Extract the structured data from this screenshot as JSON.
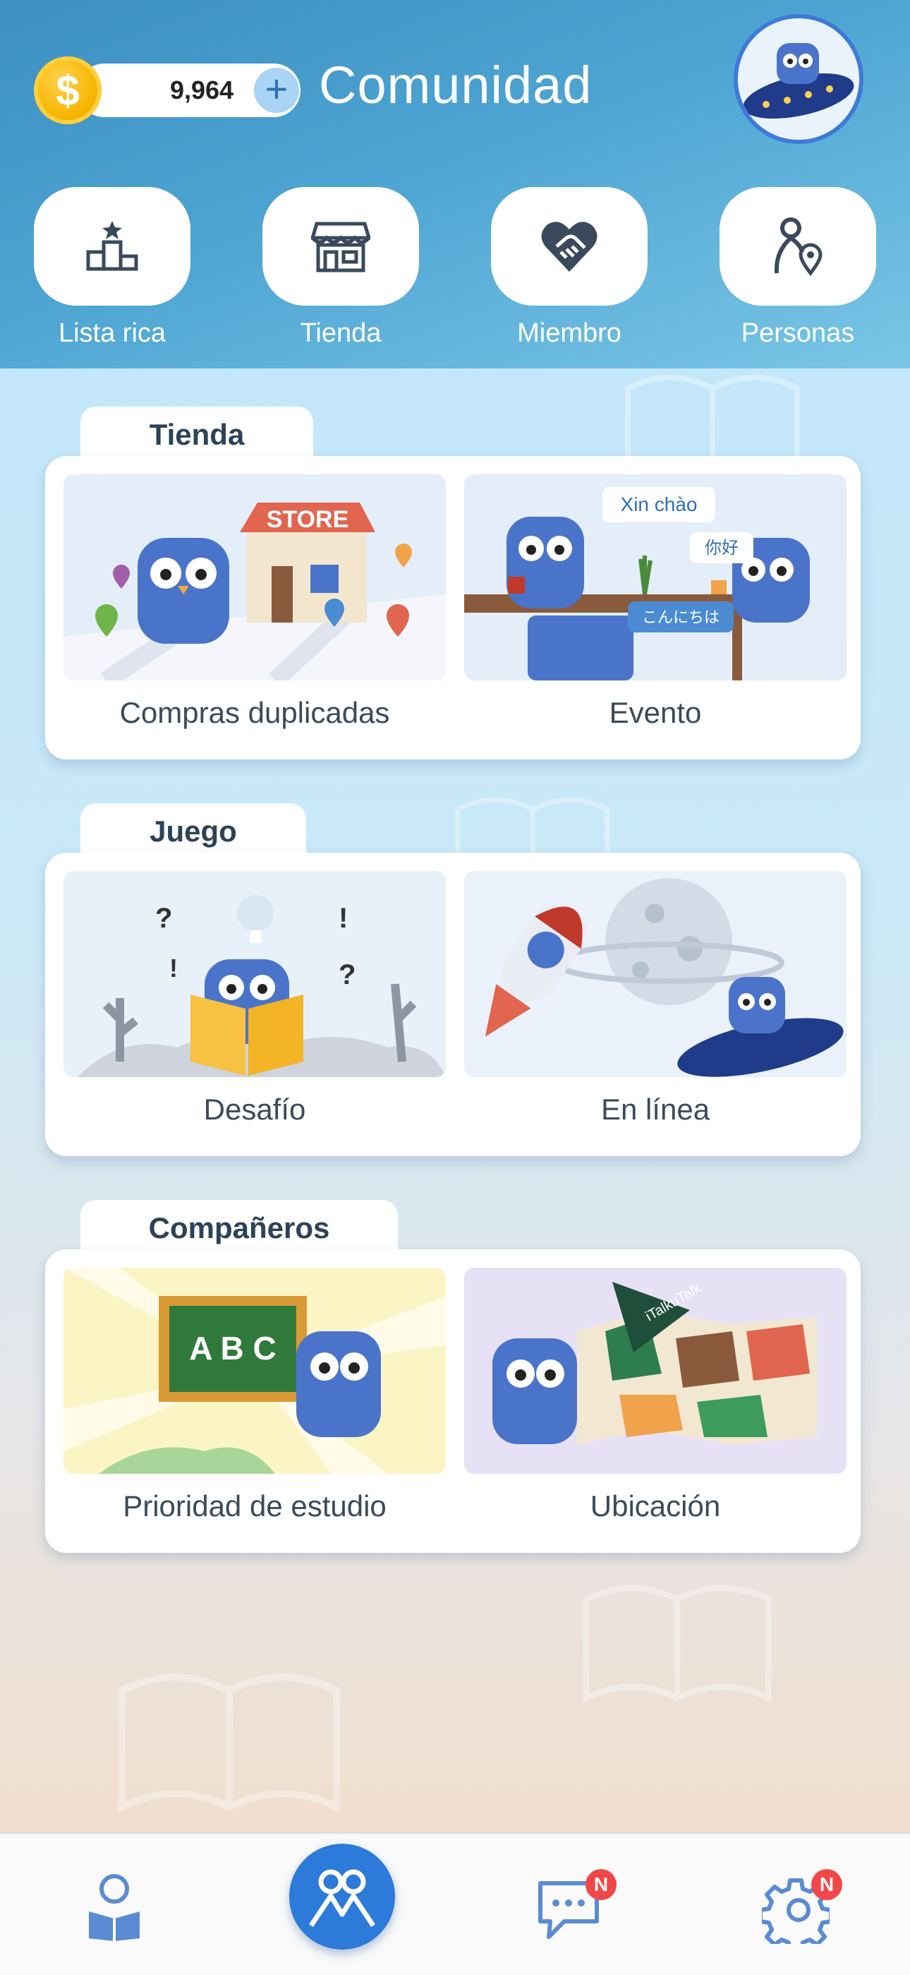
{
  "header": {
    "coins": "9,964",
    "title": "Comunidad",
    "quick_actions": [
      {
        "label": "Lista rica",
        "icon": "podium-icon"
      },
      {
        "label": "Tienda",
        "icon": "store-icon"
      },
      {
        "label": "Miembro",
        "icon": "heart-handshake-icon"
      },
      {
        "label": "Personas",
        "icon": "person-location-icon"
      }
    ]
  },
  "sections": [
    {
      "title": "Tienda",
      "items": [
        {
          "label": "Compras duplicadas"
        },
        {
          "label": "Evento"
        }
      ]
    },
    {
      "title": "Juego",
      "items": [
        {
          "label": "Desafío"
        },
        {
          "label": "En línea"
        }
      ]
    },
    {
      "title": "Compañeros",
      "items": [
        {
          "label": "Prioridad de estudio"
        },
        {
          "label": "Ubicación"
        }
      ]
    }
  ],
  "illustrations": {
    "store_sign": "STORE",
    "bubble_vi": "Xin chào",
    "bubble_zh": "你好",
    "bubble_ja": "こんにちは",
    "board_text": "A B C",
    "flag_text": "iTalkuTalk"
  },
  "bottom_nav": {
    "chat_badge": "N",
    "settings_badge": "N"
  },
  "colors": {
    "header": "#4da4d2",
    "accent": "#2c7ad9",
    "badge": "#f04848",
    "owl": "#4a74c9"
  }
}
